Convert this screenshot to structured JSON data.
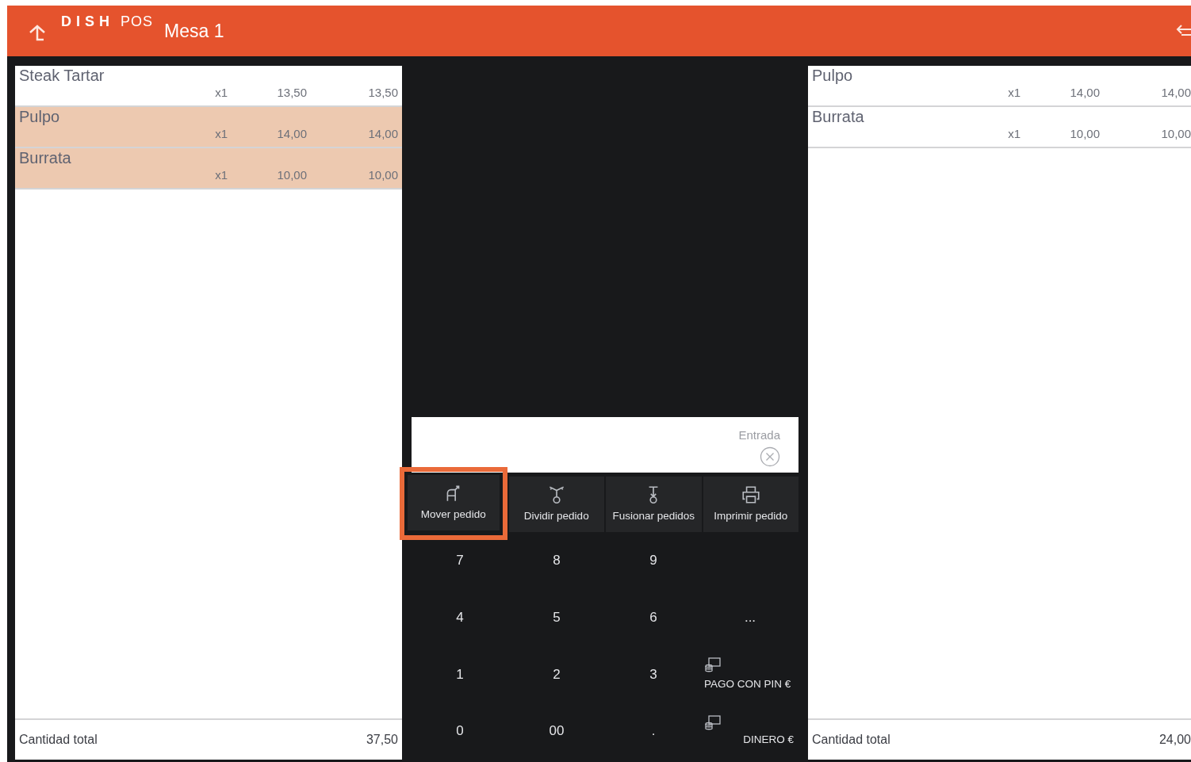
{
  "header": {
    "logo_bold": "DISH",
    "logo_light": "POS",
    "title": "Mesa 1"
  },
  "left_order": {
    "items": [
      {
        "name": "Steak Tartar",
        "qty": "x1",
        "price": "13,50",
        "total": "13,50",
        "selected": false
      },
      {
        "name": "Pulpo",
        "qty": "x1",
        "price": "14,00",
        "total": "14,00",
        "selected": true
      },
      {
        "name": "Burrata",
        "qty": "x1",
        "price": "10,00",
        "total": "10,00",
        "selected": true
      }
    ],
    "total_label": "Cantidad total",
    "total": "37,50"
  },
  "input": {
    "placeholder": "Entrada"
  },
  "actions": [
    {
      "label": "Mover pedido",
      "kind": "move",
      "highlighted": true
    },
    {
      "label": "Dividir pedido",
      "kind": "split",
      "highlighted": false
    },
    {
      "label": "Fusionar pedidos",
      "kind": "merge",
      "highlighted": false
    },
    {
      "label": "Imprimir pedido",
      "kind": "print",
      "highlighted": false
    }
  ],
  "keypad": [
    [
      {
        "label": "7",
        "kind": "key"
      },
      {
        "label": "8",
        "kind": "key"
      },
      {
        "label": "9",
        "kind": "key"
      }
    ],
    [
      {
        "label": "4",
        "kind": "key"
      },
      {
        "label": "5",
        "kind": "key"
      },
      {
        "label": "6",
        "kind": "key"
      },
      {
        "label": "...",
        "kind": "key"
      }
    ],
    [
      {
        "label": "1",
        "kind": "key"
      },
      {
        "label": "2",
        "kind": "key"
      },
      {
        "label": "3",
        "kind": "key"
      },
      {
        "label": "PAGO CON PIN €",
        "kind": "payment"
      }
    ],
    [
      {
        "label": "0",
        "kind": "key"
      },
      {
        "label": "00",
        "kind": "key"
      },
      {
        "label": ".",
        "kind": "key"
      },
      {
        "label": "DINERO €",
        "kind": "payment_bottom"
      }
    ]
  ],
  "right_order": {
    "items": [
      {
        "name": "Pulpo",
        "qty": "x1",
        "price": "14,00",
        "total": "14,00",
        "selected": false
      },
      {
        "name": "Burrata",
        "qty": "x1",
        "price": "10,00",
        "total": "10,00",
        "selected": false
      }
    ],
    "total_label": "Cantidad total",
    "total": "24,00"
  }
}
